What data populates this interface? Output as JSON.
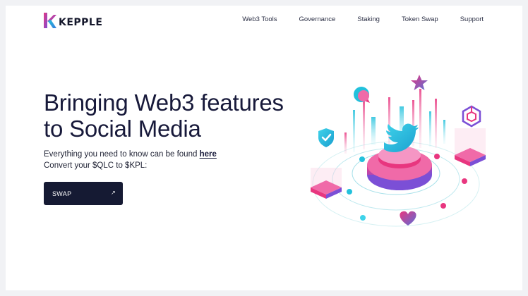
{
  "header": {
    "brand": "KEPPLE",
    "nav": [
      "Web3 Tools",
      "Governance",
      "Staking",
      "Token Swap",
      "Support"
    ]
  },
  "hero": {
    "title_line1": "Bringing Web3 features",
    "title_line2": "to Social Media",
    "line1_text": "Everything you need to know can be found ",
    "line1_link": "here",
    "line2_text": "Convert your $QLC to $KPL:",
    "cta_label": "SWAP",
    "cta_arrow": "↗"
  },
  "colors": {
    "primary_dark": "#151a33",
    "accent_pink": "#e8367f",
    "accent_cyan": "#22c1dc",
    "accent_purple": "#7b4fd6"
  },
  "icons": [
    "kepple-logo",
    "twitter-bird-icon",
    "shield-check-icon",
    "star-icon",
    "heart-icon",
    "chat-bubble-icon",
    "cube-icon"
  ]
}
